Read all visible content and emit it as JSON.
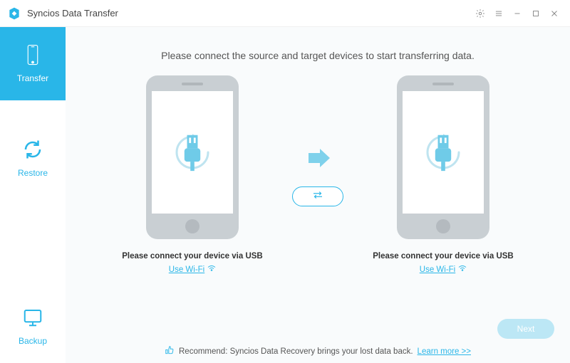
{
  "titlebar": {
    "title": "Syncios Data Transfer"
  },
  "sidebar": {
    "items": [
      {
        "label": "Transfer"
      },
      {
        "label": "Restore"
      },
      {
        "label": "Backup"
      }
    ]
  },
  "main": {
    "instruction": "Please connect the source and target devices to start transferring data.",
    "source": {
      "connect_label": "Please connect your device via USB",
      "wifi_label": "Use Wi-Fi"
    },
    "target": {
      "connect_label": "Please connect your device via USB",
      "wifi_label": "Use Wi-Fi"
    },
    "next_label": "Next"
  },
  "footer": {
    "recommend_text": "Recommend: Syncios Data Recovery brings your lost data back.",
    "learn_more": "Learn more >>"
  }
}
